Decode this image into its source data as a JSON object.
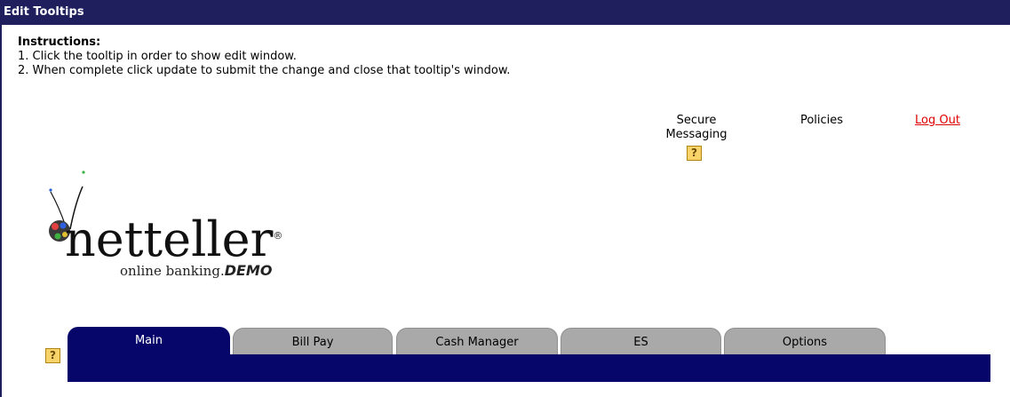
{
  "window": {
    "title": "Edit Tooltips"
  },
  "instructions": {
    "title": "Instructions:",
    "step1": "1. Click the tooltip in order to show edit window.",
    "step2": "2. When complete click update to submit the change and close that tooltip's window."
  },
  "toplinks": {
    "secure_line1": "Secure",
    "secure_line2": "Messaging",
    "policies": "Policies",
    "logout": "Log Out"
  },
  "tooltip_marker": "?",
  "logo": {
    "wordmark": "netteller",
    "subtitle": "online banking.",
    "demo": "DEMO",
    "registered": "®"
  },
  "tabs": [
    {
      "label": "Main",
      "active": true
    },
    {
      "label": "Bill Pay",
      "active": false
    },
    {
      "label": "Cash Manager",
      "active": false
    },
    {
      "label": "ES",
      "active": false
    },
    {
      "label": "Options",
      "active": false
    }
  ],
  "colors": {
    "title_bar": "#1f1f5e",
    "tab_active": "#06066a",
    "tab_inactive": "#a9a9a9",
    "logout_link": "#e00000",
    "tooltip_box": "#f7d36a"
  }
}
